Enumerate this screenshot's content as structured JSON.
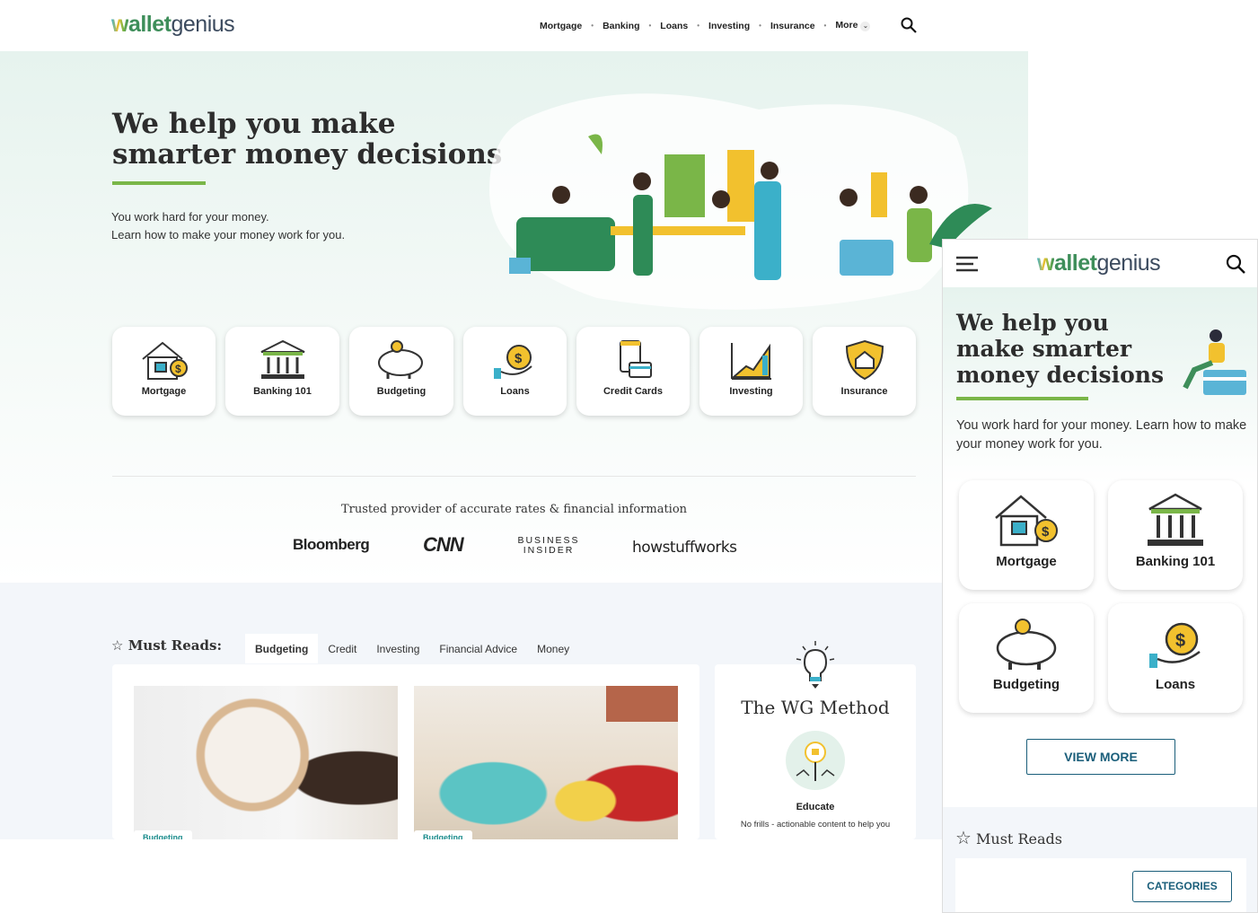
{
  "header": {
    "logo_bold": "wallet",
    "logo_light": "genius",
    "nav": [
      "Mortgage",
      "Banking",
      "Loans",
      "Investing",
      "Insurance",
      "More"
    ],
    "search_icon": "search-icon"
  },
  "hero": {
    "title_line1": "We help you make",
    "title_line2": "smarter money decisions",
    "sub1": "You work hard for your money.",
    "sub2": "Learn how to make your money work for you."
  },
  "categories": [
    {
      "label": "Mortgage",
      "icon": "house-dollar-icon"
    },
    {
      "label": "Banking 101",
      "icon": "bank-icon"
    },
    {
      "label": "Budgeting",
      "icon": "piggy-bank-icon"
    },
    {
      "label": "Loans",
      "icon": "money-bag-hand-icon"
    },
    {
      "label": "Credit Cards",
      "icon": "credit-card-icon"
    },
    {
      "label": "Investing",
      "icon": "chart-up-icon"
    },
    {
      "label": "Insurance",
      "icon": "shield-house-icon"
    }
  ],
  "trusted": {
    "title": "Trusted provider of accurate rates & financial information",
    "logos": [
      "Bloomberg",
      "CNN",
      "BUSINESS INSIDER",
      "howstuffworks"
    ]
  },
  "must_reads": {
    "title": "Must Reads:",
    "tabs": [
      "Budgeting",
      "Credit",
      "Investing",
      "Financial Advice",
      "Money"
    ],
    "active_tab": "Budgeting",
    "articles": [
      {
        "badge": "Budgeting"
      },
      {
        "badge": "Budgeting"
      }
    ]
  },
  "wg_method": {
    "title": "The WG Method",
    "step": "Educate",
    "desc": "No frills - actionable content to help you"
  },
  "mobile": {
    "title": "We help you make smarter money decisions",
    "sub": "You work hard for your money. Learn how to make your money work for you.",
    "categories": [
      "Mortgage",
      "Banking 101",
      "Budgeting",
      "Loans"
    ],
    "view_more": "VIEW MORE",
    "must_reads": "Must Reads",
    "categories_btn": "CATEGORIES"
  },
  "colors": {
    "accent_green": "#7ab648",
    "brand_teal": "#1a5e7a",
    "hero_bg": "#e6f3ee"
  }
}
